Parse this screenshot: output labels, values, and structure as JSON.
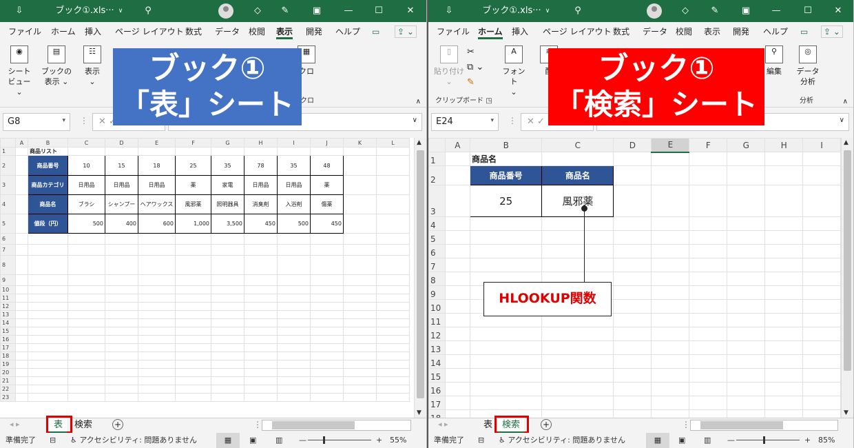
{
  "left": {
    "title": "ブック①.xls···",
    "menu": [
      "ファイル",
      "ホーム",
      "挿入",
      "ページ レイアウト",
      "数式",
      "データ",
      "校閲",
      "表示",
      "開発",
      "ヘルプ"
    ],
    "menu_selected": "表示",
    "ribbon": {
      "b1": "シート",
      "b1b": "ビュー ⌄",
      "b2": "ブックの",
      "b2b": "表示 ⌄",
      "b3": "表示",
      "b3b": "⌄",
      "b4": "クロ",
      "b4b": "クロ"
    },
    "namebox": "G8",
    "overlay": {
      "line1": "ブック①",
      "line2": "「表」シート",
      "color": "#4472c4"
    },
    "sheet": {
      "cols": [
        "A",
        "B",
        "C",
        "D",
        "E",
        "F",
        "G",
        "H",
        "I",
        "J",
        "K",
        "L"
      ],
      "rows": [
        "1",
        "2",
        "3",
        "4",
        "5",
        "6",
        "7",
        "8",
        "9",
        "10",
        "11",
        "12",
        "13",
        "14",
        "15",
        "16",
        "17",
        "18",
        "19",
        "20",
        "21",
        "22",
        "23"
      ],
      "title": "商品リスト",
      "row_headers": [
        "商品番号",
        "商品カテゴリ",
        "商品名",
        "値段（円）"
      ],
      "numbers": [
        "10",
        "15",
        "18",
        "25",
        "35",
        "78",
        "35",
        "48"
      ],
      "categories": [
        "日用品",
        "日用品",
        "日用品",
        "薬",
        "家電",
        "日用品",
        "日用品",
        "薬"
      ],
      "names": [
        "ブラシ",
        "シャンプー",
        "ヘアワックス",
        "風邪薬",
        "照明器具",
        "消臭剤",
        "入浴剤",
        "傷薬"
      ],
      "prices": [
        "500",
        "400",
        "600",
        "1,000",
        "3,500",
        "450",
        "500",
        "450"
      ]
    },
    "tabs": [
      "表",
      "検索"
    ],
    "status": {
      "ready": "準備完了",
      "access": "アクセシビリティ: 問題ありません",
      "zoom": "55%"
    }
  },
  "right": {
    "title": "ブック①.xls···",
    "menu": [
      "ファイル",
      "ホーム",
      "挿入",
      "ページ レイアウト",
      "数式",
      "データ",
      "校閲",
      "表示",
      "開発",
      "ヘルプ"
    ],
    "menu_selected": "ホーム",
    "ribbon": {
      "paste": "貼り付け",
      "font": "フォント",
      "align": "配",
      "edit": "編集",
      "data1": "データ",
      "data2": "分析",
      "clip": "クリップボード",
      "anal": "分析"
    },
    "namebox": "E24",
    "overlay": {
      "line1": "ブック①",
      "line2": "「検索」シート",
      "color": "#ff0000"
    },
    "sheet": {
      "cols": [
        "A",
        "B",
        "C",
        "D",
        "E",
        "F",
        "G",
        "H",
        "I"
      ],
      "rows": [
        "1",
        "2",
        "3",
        "4",
        "5",
        "6",
        "7",
        "8",
        "9",
        "10",
        "11",
        "12",
        "13",
        "14",
        "15",
        "16",
        "17",
        "18"
      ],
      "title": "商品名",
      "h1": "商品番号",
      "h2": "商品名",
      "v1": "25",
      "v2": "風邪薬"
    },
    "callout": "HLOOKUP関数",
    "tabs": [
      "表",
      "検索"
    ],
    "status": {
      "ready": "準備完了",
      "access": "アクセシビリティ: 問題ありません",
      "zoom": "85%"
    }
  }
}
